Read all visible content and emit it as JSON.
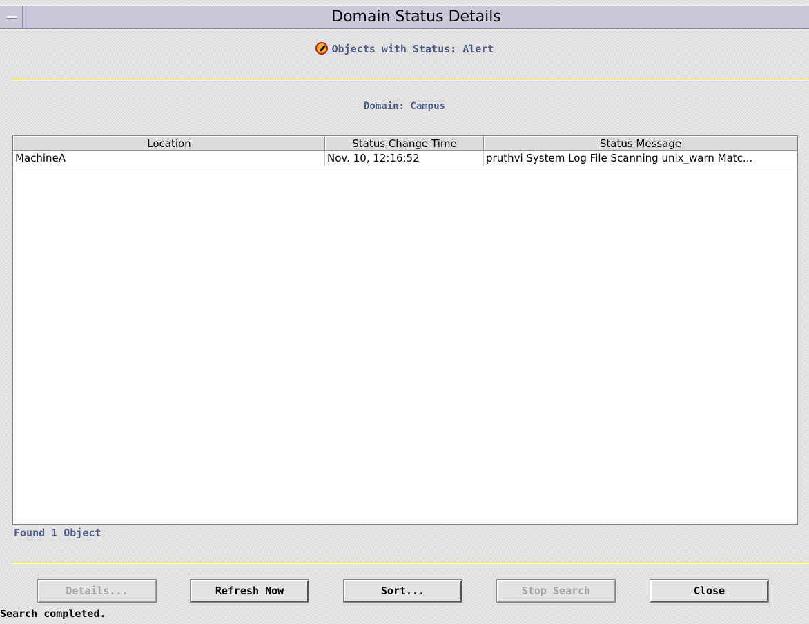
{
  "window": {
    "title": "Domain Status Details"
  },
  "status_heading": {
    "text": "Objects with Status: Alert",
    "icon": "alert-icon"
  },
  "domain": {
    "label": "Domain: Campus"
  },
  "table": {
    "columns": [
      "Location",
      "Status Change Time",
      "Status Message"
    ],
    "rows": [
      {
        "location": "MachineA",
        "time": "Nov. 10, 12:16:52",
        "message": "pruthvi System Log File Scanning unix_warn Matc..."
      }
    ]
  },
  "found_text": "Found 1 Object",
  "buttons": {
    "details": "Details...",
    "refresh": "Refresh Now",
    "sort": "Sort...",
    "stop": "Stop Search",
    "close": "Close"
  },
  "statusbar": "Search completed.",
  "colors": {
    "accent": "#4e5d8a",
    "divider": "#f5ef3e",
    "titlebar": "#c9c9d9"
  }
}
